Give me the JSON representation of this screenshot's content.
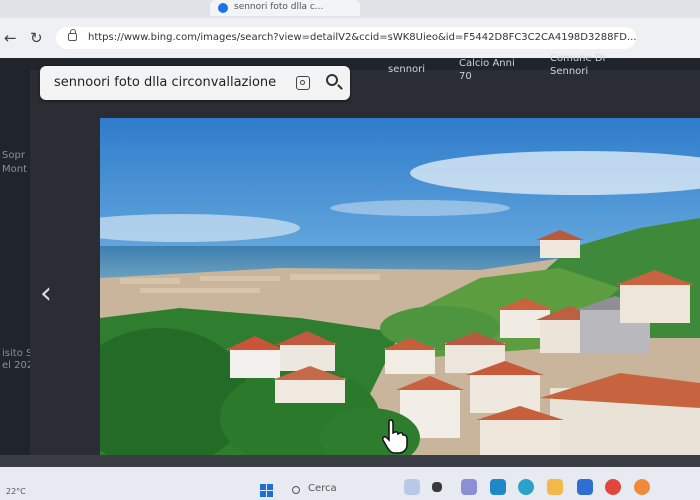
{
  "browser": {
    "tab_title": "sennori foto dlla c...",
    "url": "https://www.bing.com/images/search?view=detailV2&ccid=sWK8Uieo&id=F5442D8FC3C2CA4198D3288FD...",
    "icons": {
      "back": "back-arrow-icon",
      "reload": "reload-icon",
      "lock": "lock-icon"
    }
  },
  "sidebar": {
    "label_1": "Sopr",
    "label_2": "Mont",
    "label_3": "isito S",
    "label_4": "el 202"
  },
  "search": {
    "query": "sennoori foto dlla circonvallazione"
  },
  "related": [
    {
      "line1": "sennori",
      "line2": ""
    },
    {
      "line1": "Calcio Anni",
      "line2": "70"
    },
    {
      "line1": "Comune Di",
      "line2": "Sennori"
    }
  ],
  "viewer": {
    "prev_arrow": "‹"
  },
  "taskbar": {
    "temperature": "22°C",
    "search_label": "Cerca"
  },
  "colors": {
    "accent": "#1d6fd8",
    "viewer_bg": "#2a2d33"
  }
}
